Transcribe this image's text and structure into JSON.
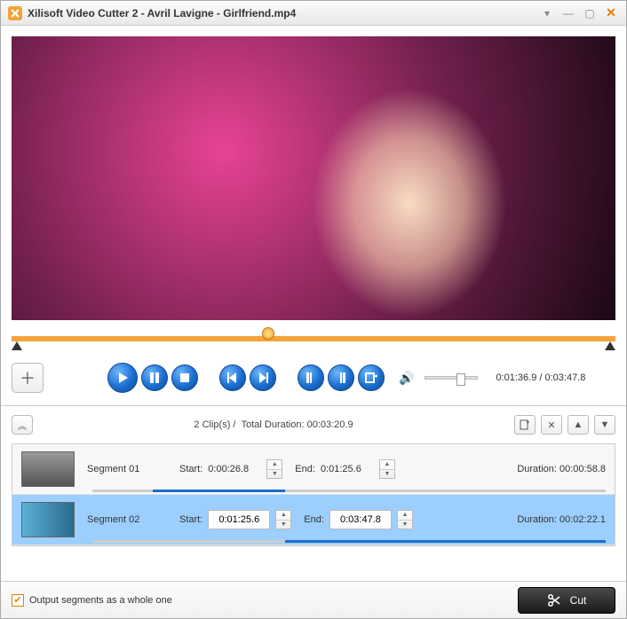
{
  "window": {
    "title": "Xilisoft Video Cutter 2 - Avril Lavigne - Girlfriend.mp4"
  },
  "timeline": {
    "playhead_pct": 42.5,
    "fill_pct": 100
  },
  "playback": {
    "current_time": "0:01:36.9",
    "total_time": "0:03:47.8"
  },
  "clips_summary": {
    "count_label": "2 Clip(s)",
    "total_label": "Total Duration:",
    "total_value": "00:03:20.9"
  },
  "clips": [
    {
      "name": "Segment 01",
      "start_label": "Start:",
      "start": "0:00:26.8",
      "end_label": "End:",
      "end": "0:01:25.6",
      "duration_label": "Duration:",
      "duration": "00:00:58.8",
      "selected": false,
      "progress_left_pct": 11.8,
      "progress_width_pct": 25.8
    },
    {
      "name": "Segment 02",
      "start_label": "Start:",
      "start": "0:01:25.6",
      "end_label": "End:",
      "end": "0:03:47.8",
      "duration_label": "Duration:",
      "duration": "00:02:22.1",
      "selected": true,
      "progress_left_pct": 37.6,
      "progress_width_pct": 62.4
    }
  ],
  "footer": {
    "checkbox_checked": true,
    "checkbox_label": "Output segments as a whole one",
    "cut_label": "Cut"
  }
}
